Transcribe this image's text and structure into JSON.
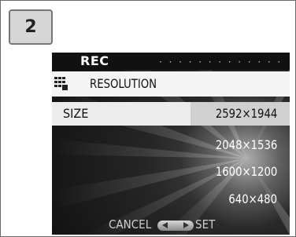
{
  "step": "2",
  "screen": {
    "header_title": "REC",
    "menu_item": "RESOLUTION",
    "menu_item_icon": "resolution-grid-icon",
    "setting_label": "SIZE",
    "options": [
      "2592×1944",
      "2048×1536",
      "1600×1200",
      "640×480"
    ],
    "selected_option": "2592×1944"
  },
  "footer": {
    "cancel_label": "CANCEL",
    "set_label": "SET",
    "cancel_icon": "left-arrow-icon",
    "set_icon": "right-arrow-icon"
  },
  "colors": {
    "header_bg": "#111111",
    "selected_bg": "#d0d0d0",
    "text_light": "#ffffff",
    "text_dark": "#111111"
  }
}
